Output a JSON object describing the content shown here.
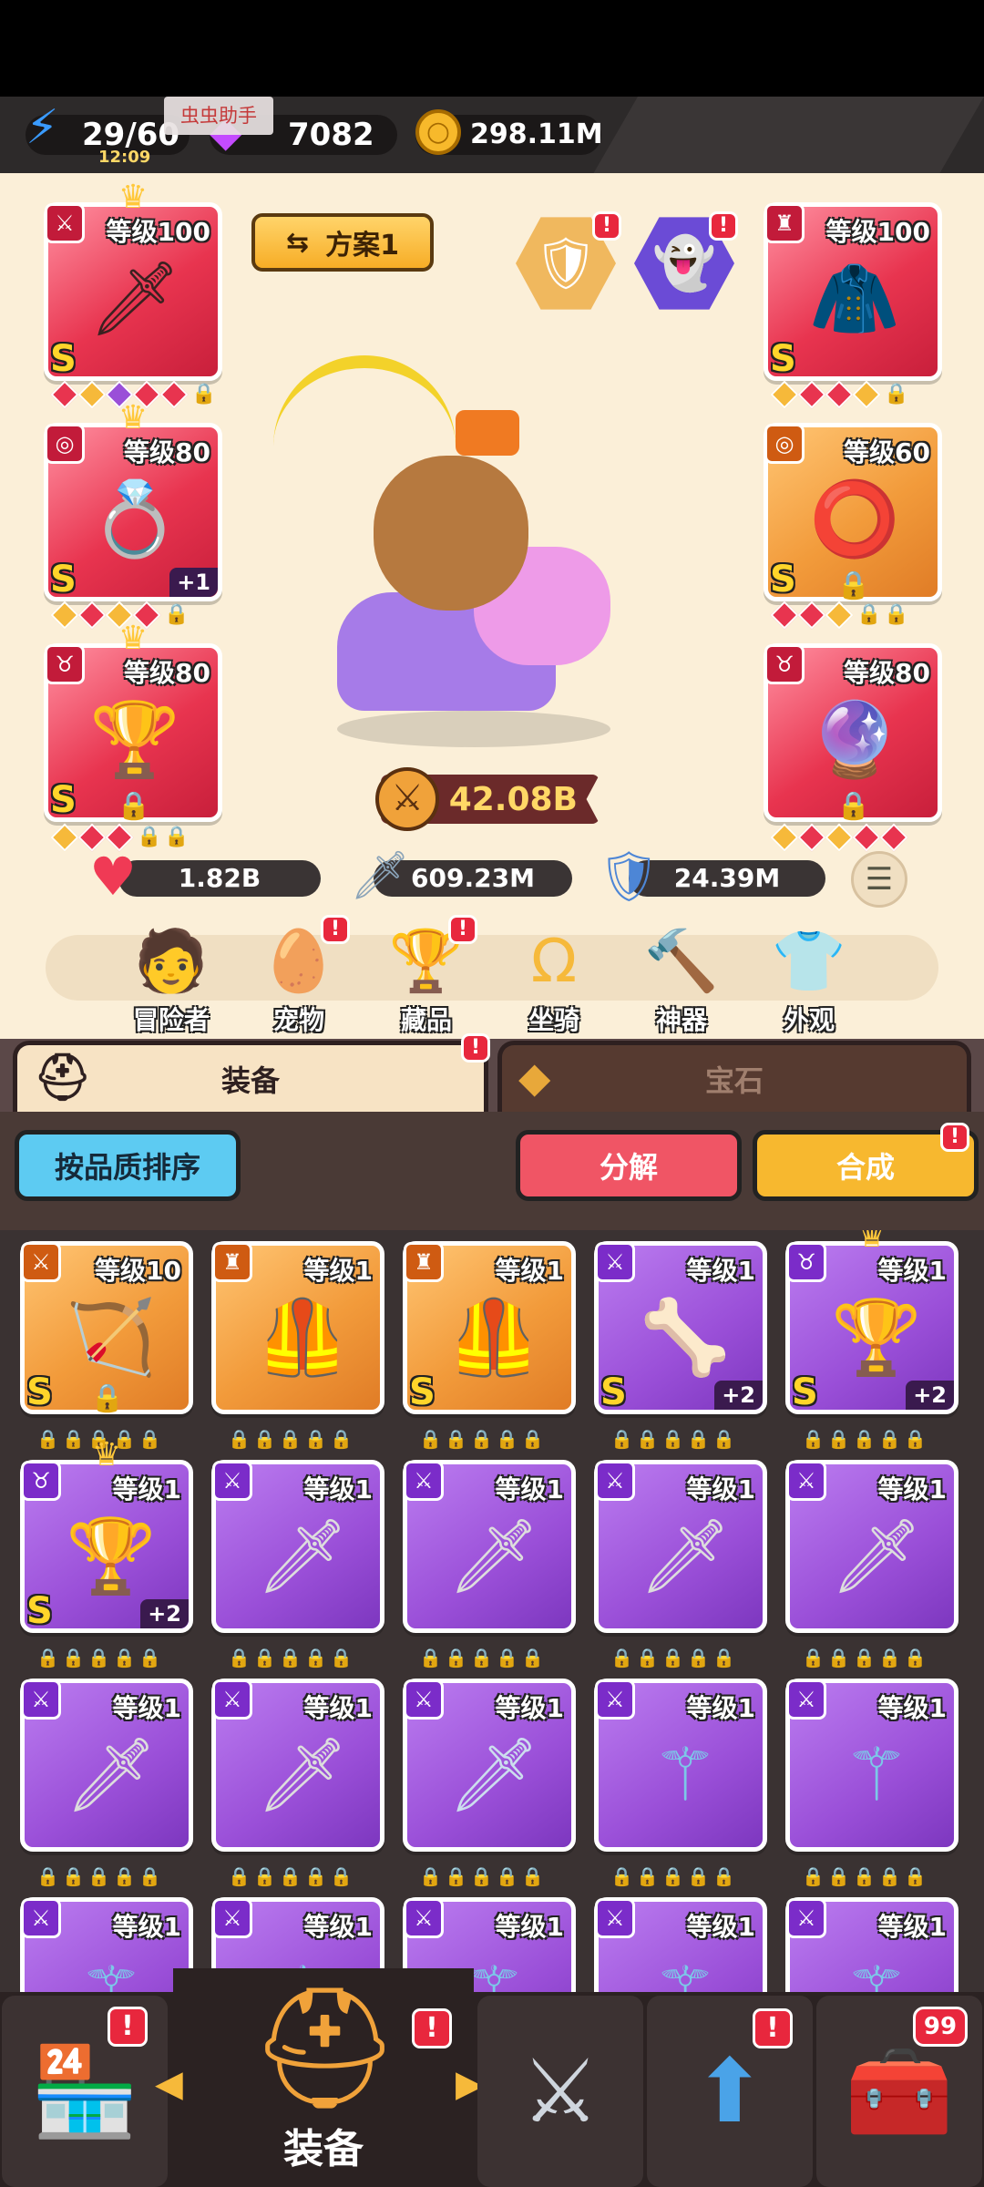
{
  "resources": {
    "energy": "29/60",
    "energy_timer": "12:09",
    "gems": "7082",
    "gold": "298.11M",
    "overlay_label": "虫虫助手"
  },
  "loadout": {
    "plan_label": "方案1",
    "power": "42.08B"
  },
  "equipped": {
    "weapon": {
      "level": "等级100",
      "grade": "S"
    },
    "ring": {
      "level": "等级80",
      "grade": "S",
      "plus": "+1"
    },
    "trophy": {
      "level": "等级80",
      "grade": "S"
    },
    "armor": {
      "level": "等级100",
      "grade": "S"
    },
    "bracelet": {
      "level": "等级60",
      "grade": "S"
    },
    "necklace": {
      "level": "等级80"
    }
  },
  "stats": {
    "hp": "1.82B",
    "attack": "609.23M",
    "defense": "24.39M"
  },
  "nav": [
    {
      "label": "冒险者",
      "icon": "adventurer-icon"
    },
    {
      "label": "宠物",
      "icon": "pet-egg-icon"
    },
    {
      "label": "藏品",
      "icon": "trophy-icon"
    },
    {
      "label": "坐骑",
      "icon": "horseshoe-icon"
    },
    {
      "label": "神器",
      "icon": "hammer-icon"
    },
    {
      "label": "外观",
      "icon": "outfit-icon"
    }
  ],
  "tabs": {
    "equip": "装备",
    "gem": "宝石"
  },
  "actions": {
    "sort": "按品质排序",
    "decompose": "分解",
    "combine": "合成"
  },
  "inventory": {
    "row1": [
      {
        "level": "等级10",
        "grade": "S"
      },
      {
        "level": "等级1"
      },
      {
        "level": "等级1",
        "grade": "S"
      },
      {
        "level": "等级1",
        "grade": "S",
        "plus": "+2"
      },
      {
        "level": "等级1",
        "grade": "S",
        "plus": "+2"
      }
    ],
    "row2": [
      {
        "level": "等级1",
        "grade": "S",
        "plus": "+2"
      },
      {
        "level": "等级1"
      },
      {
        "level": "等级1"
      },
      {
        "level": "等级1"
      },
      {
        "level": "等级1"
      }
    ],
    "row3": [
      {
        "level": "等级1"
      },
      {
        "level": "等级1"
      },
      {
        "level": "等级1"
      },
      {
        "level": "等级1"
      },
      {
        "level": "等级1"
      }
    ],
    "row4": [
      {
        "level": "等级1"
      },
      {
        "level": "等级1"
      },
      {
        "level": "等级1"
      },
      {
        "level": "等级1"
      },
      {
        "level": "等级1"
      }
    ]
  },
  "bottom_nav": {
    "active_label": "装备",
    "chest_count": "99"
  },
  "colors": {
    "red_slot": "#e8344f",
    "purple_slot": "#9a4fd8",
    "orange_slot": "#f29b3b",
    "gold": "#ffd52a"
  }
}
